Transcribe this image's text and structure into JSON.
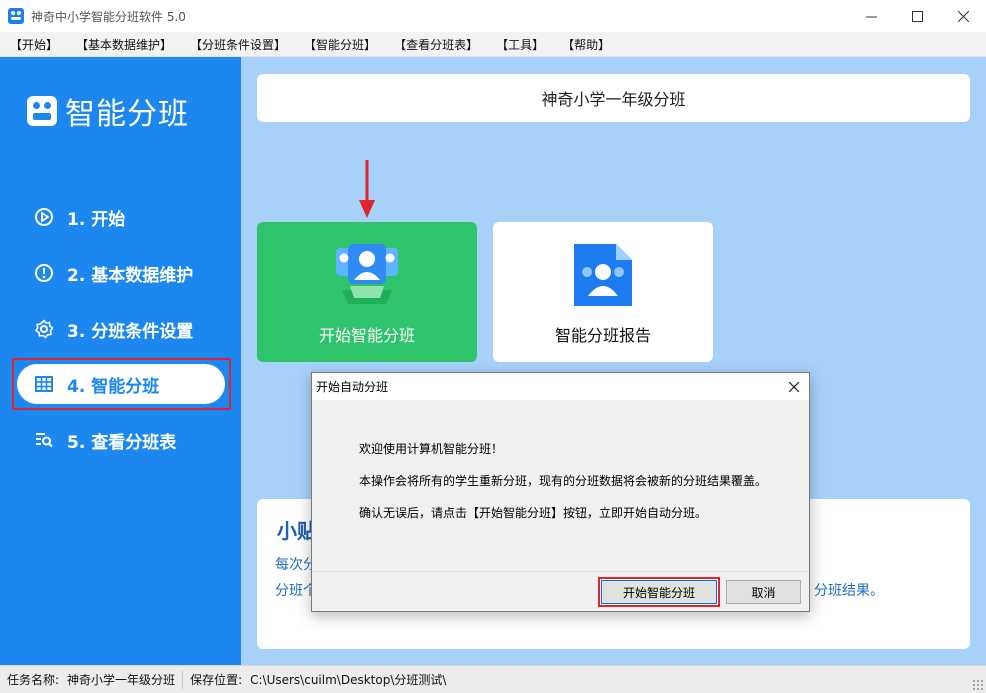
{
  "window": {
    "title": "神奇中小学智能分班软件 5.0",
    "minimize": "—",
    "maximize": "☐",
    "close": "✕"
  },
  "menu": [
    "【开始】",
    "【基本数据维护】",
    "【分班条件设置】",
    "【智能分班】",
    "【查看分班表】",
    "【工具】",
    "【帮助】"
  ],
  "sidebar": {
    "logo_text": "智能分班",
    "items": [
      {
        "label": "1. 开始",
        "icon": "play-circle-icon"
      },
      {
        "label": "2. 基本数据维护",
        "icon": "info-circle-icon"
      },
      {
        "label": "3. 分班条件设置",
        "icon": "gear-icon"
      },
      {
        "label": "4. 智能分班",
        "icon": "grid-table-icon",
        "active": true
      },
      {
        "label": "5. 查看分班表",
        "icon": "list-search-icon"
      }
    ]
  },
  "main": {
    "header_title": "神奇小学一年级分班",
    "cards": [
      {
        "label": "开始智能分班",
        "icon": "students-group-icon",
        "color": "#2fc46b"
      },
      {
        "label": "智能分班报告",
        "icon": "report-document-icon",
        "color": "#ffffff"
      }
    ],
    "tips": {
      "title": "小贴",
      "line1": "每次分",
      "line2": "分班个",
      "tail": "分班结果。"
    }
  },
  "dialog": {
    "title": "开始自动分班",
    "close": "✕",
    "lines": [
      "欢迎使用计算机智能分班！",
      "本操作会将所有的学生重新分班，现有的分班数据将会被新的分班结果覆盖。",
      "确认无误后，请点击【开始智能分班】按钮，立即开始自动分班。"
    ],
    "ok_label": "开始智能分班",
    "cancel_label": "取消"
  },
  "status": {
    "task_label": "任务名称:",
    "task_value": "神奇小学一年级分班",
    "save_label": "保存位置:",
    "save_value": "C:\\Users\\cuilm\\Desktop\\分班测试\\"
  },
  "colors": {
    "sidebar": "#1b87ef",
    "main_bg": "#a8d1fa",
    "highlight": "#e0242d",
    "tips_text": "#1f6fbf"
  }
}
